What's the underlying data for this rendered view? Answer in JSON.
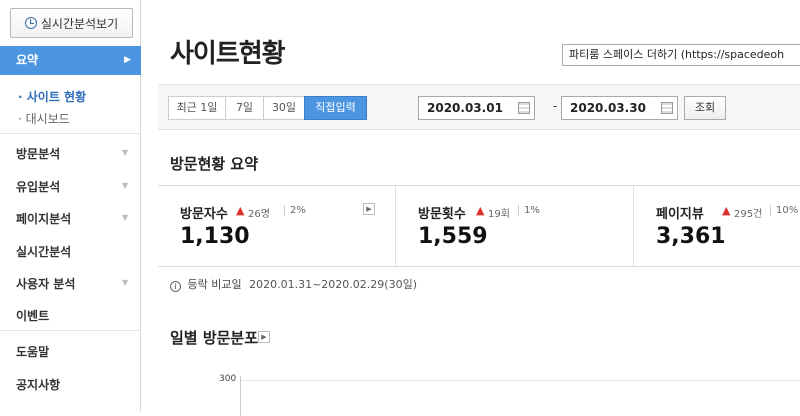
{
  "sidebar": {
    "realtime_button": "실시간분석보기",
    "summary": {
      "label": "요약",
      "arrow": "▶"
    },
    "subitems": [
      {
        "label": "· 사이트 현황"
      },
      {
        "label": "· 대시보드"
      }
    ],
    "menus": [
      {
        "label": "방문분석",
        "caret": "▼"
      },
      {
        "label": "유입분석",
        "caret": "▼"
      },
      {
        "label": "페이지분석",
        "caret": "▼"
      },
      {
        "label": "실시간분석"
      },
      {
        "label": "사용자 분석",
        "caret": "▼"
      },
      {
        "label": "이벤트"
      },
      {
        "label": "도움말"
      },
      {
        "label": "공지사항"
      }
    ]
  },
  "header": {
    "title": "사이트현황",
    "site_select": "파티룸 스페이스 더하기 (https://spacedeoh"
  },
  "toolbar": {
    "ranges": [
      "최근 1일",
      "7일",
      "30일",
      "직접입력"
    ],
    "selected_range": "직접입력",
    "start_date": "2020.03.01",
    "end_date": "2020.03.30",
    "dash": "-",
    "search_label": "조회"
  },
  "summary": {
    "title": "방문현황 요약",
    "cards": [
      {
        "label": "방문자수",
        "up": "▲",
        "change": "26명",
        "pct": "2%",
        "value": "1,130",
        "more": "▶"
      },
      {
        "label": "방문횟수",
        "up": "▲",
        "change": "19회",
        "pct": "1%",
        "value": "1,559"
      },
      {
        "label": "페이지뷰",
        "up": "▲",
        "change": "295건",
        "pct": "10%",
        "value": "3,361"
      }
    ],
    "compare_icon": "i",
    "compare_label": "등락 비교일",
    "compare_range": "2020.01.31~2020.02.29(30일)"
  },
  "daily": {
    "title": "일별 방문분포",
    "more": "▶",
    "y_top_tick": "300"
  },
  "colors": {
    "accent": "#4c95e0",
    "up": "#e0322f"
  }
}
